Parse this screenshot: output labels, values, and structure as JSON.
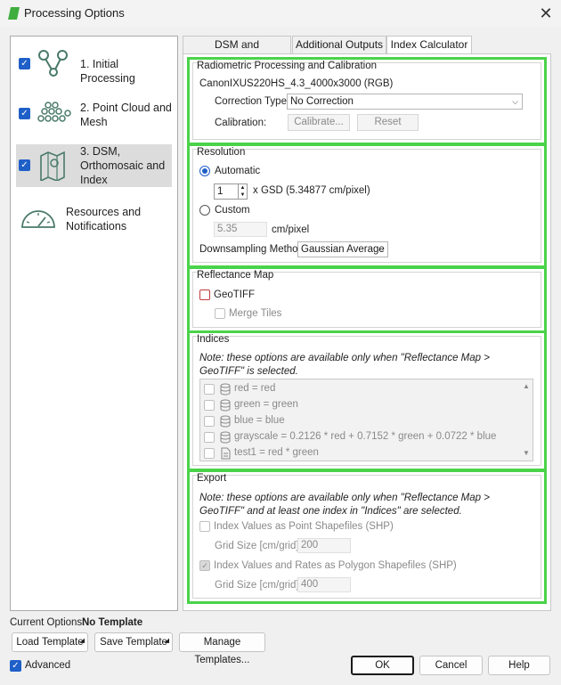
{
  "window": {
    "title": "Processing Options",
    "close_glyph": "✕"
  },
  "sidebar": {
    "items": [
      {
        "label_line1": "1. Initial Processing",
        "label_line2": "",
        "label_line3": "",
        "checked": true,
        "icon": "initial-processing-icon"
      },
      {
        "label_line1": "2. Point Cloud and",
        "label_line2": "Mesh",
        "label_line3": "",
        "checked": true,
        "icon": "point-cloud-icon"
      },
      {
        "label_line1": "3. DSM,",
        "label_line2": "Orthomosaic and",
        "label_line3": "Index",
        "checked": true,
        "icon": "dsm-map-icon"
      },
      {
        "label_line1": "Resources and",
        "label_line2": "Notifications",
        "label_line3": "",
        "checked": false,
        "icon": "gauge-icon"
      }
    ]
  },
  "tabs": [
    {
      "label": "DSM and Orthomosaic",
      "active": false
    },
    {
      "label": "Additional Outputs",
      "active": false
    },
    {
      "label": "Index Calculator",
      "active": true
    }
  ],
  "radiometric": {
    "title": "Radiometric Processing and Calibration",
    "camera": "CanonIXUS220HS_4.3_4000x3000 (RGB)",
    "correction_label": "Correction Type:",
    "correction_value": "No Correction",
    "calibration_label": "Calibration:",
    "calibrate_button": "Calibrate...",
    "reset_button": "Reset"
  },
  "resolution": {
    "title": "Resolution",
    "automatic_label": "Automatic",
    "gsd_multiplier": "1",
    "gsd_text": "x GSD (5.34877 cm/pixel)",
    "custom_label": "Custom",
    "custom_value": "5.35",
    "custom_unit": "cm/pixel",
    "downsampling_label": "Downsampling Method:",
    "downsampling_value": "Gaussian Average"
  },
  "reflectance": {
    "title": "Reflectance Map",
    "geotiff_label": "GeoTIFF",
    "merge_tiles_label": "Merge Tiles"
  },
  "indices": {
    "title": "Indices",
    "note": "Note: these options are available only when \"Reflectance Map > GeoTIFF\" is selected.",
    "rows": [
      {
        "text": "red = red",
        "icon": "database-icon"
      },
      {
        "text": "green = green",
        "icon": "database-icon"
      },
      {
        "text": "blue = blue",
        "icon": "database-icon"
      },
      {
        "text": "grayscale = 0.2126 * red + 0.7152 * green + 0.0722 * blue",
        "icon": "database-icon"
      },
      {
        "text": "test1 = red * green",
        "icon": "document-icon"
      }
    ]
  },
  "export": {
    "title": "Export",
    "note": "Note: these options are available only when \"Reflectance Map > GeoTIFF\" and at least one index in \"Indices\" are selected.",
    "point_shp_label": "Index Values as Point Shapefiles (SHP)",
    "grid_label_1": "Grid Size [cm/grid]:",
    "grid_value_1": "200",
    "polygon_shp_label": "Index Values and Rates as Polygon Shapefiles (SHP)",
    "grid_label_2": "Grid Size [cm/grid]:",
    "grid_value_2": "400"
  },
  "footer": {
    "current_options_label": "Current Options:",
    "current_options_value": "No Template",
    "load_template": "Load Template",
    "save_template": "Save Template",
    "manage_templates": "Manage Templates...",
    "advanced_label": "Advanced",
    "ok": "OK",
    "cancel": "Cancel",
    "help": "Help"
  },
  "colors": {
    "accent": "#1f5fc8",
    "highlight_border": "#4ad34a",
    "app_icon": "#3fae3f"
  }
}
